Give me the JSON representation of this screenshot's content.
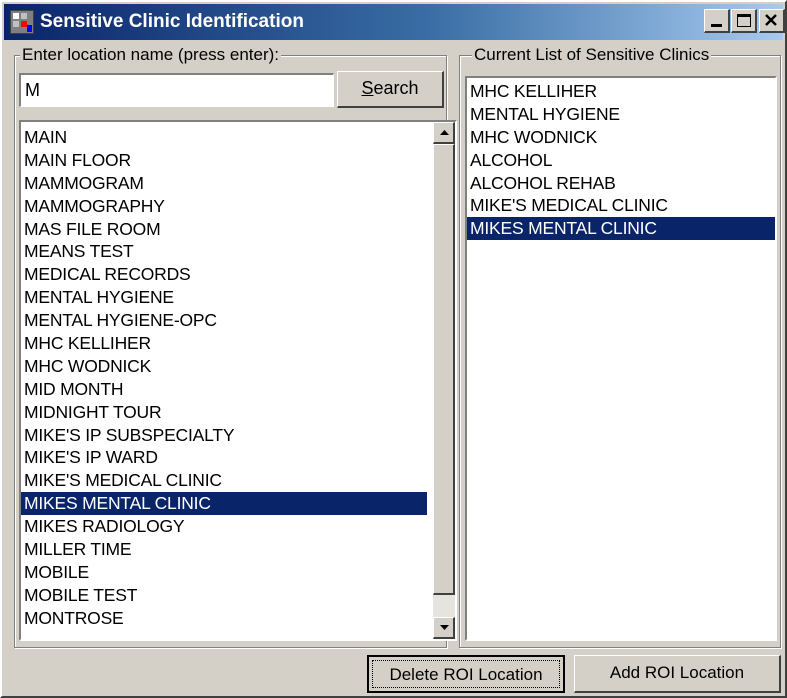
{
  "window": {
    "title": "Sensitive Clinic Identification",
    "icons": {
      "app": "app-icon",
      "minimize": "minimize-icon",
      "maximize": "maximize-icon",
      "close": "close-icon"
    }
  },
  "search": {
    "group_label": "Enter location name (press enter):",
    "value": "M",
    "button_label_underlined": "S",
    "button_label_rest": "earch"
  },
  "locations": {
    "items": [
      "MAIN",
      "MAIN FLOOR",
      "MAMMOGRAM",
      "MAMMOGRAPHY",
      "MAS FILE ROOM",
      "MEANS TEST",
      "MEDICAL RECORDS",
      "MENTAL HYGIENE",
      "MENTAL HYGIENE-OPC",
      "MHC KELLIHER",
      "MHC WODNICK",
      "MID MONTH",
      "MIDNIGHT TOUR",
      "MIKE'S IP SUBSPECIALTY",
      "MIKE'S IP WARD",
      "MIKE'S MEDICAL CLINIC",
      "MIKES MENTAL CLINIC",
      "MIKES RADIOLOGY",
      "MILLER TIME",
      "MOBILE",
      "MOBILE TEST",
      "MONTROSE"
    ],
    "selected": "MIKES MENTAL CLINIC"
  },
  "sensitive": {
    "group_label": "Current List of Sensitive Clinics",
    "items": [
      "MHC KELLIHER",
      "MENTAL HYGIENE",
      "MHC WODNICK",
      "ALCOHOL",
      "ALCOHOL REHAB",
      "MIKE'S MEDICAL CLINIC",
      "MIKES MENTAL CLINIC"
    ],
    "selected": "MIKES MENTAL CLINIC"
  },
  "actions": {
    "delete_label": "Delete ROI Location",
    "add_label": "Add ROI Location"
  },
  "colors": {
    "title_gradient_start": "#0a246a",
    "title_gradient_end": "#a6caf0",
    "selection": "#0a246a",
    "face": "#d4d0c8"
  }
}
